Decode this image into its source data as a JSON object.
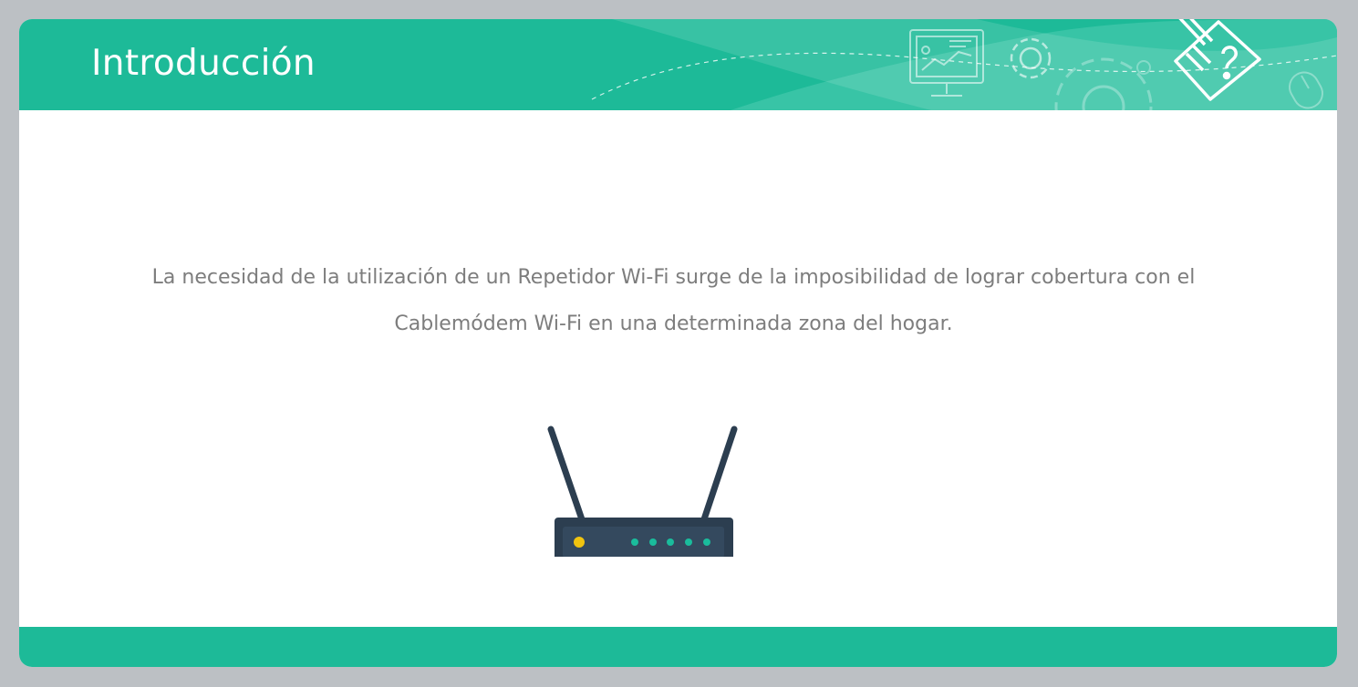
{
  "slide": {
    "title": "Introducción",
    "body_text": "La necesidad de la utilización de un Repetidor Wi-Fi surge de la imposibilidad de lograr cobertura con el Cablemódem Wi-Fi en una determinada zona del hogar."
  },
  "icons": {
    "header_decoration": [
      "presentation-monitor-icon",
      "gear-icon",
      "large-gear-icon",
      "mouse-icon",
      "help-document-icon"
    ],
    "illustration": "wifi-router-icon"
  },
  "colors": {
    "accent": "#1dba98",
    "accent_light": "#4ccdb1",
    "background": "#bcc0c4",
    "body_text": "#7d7d7d",
    "router_body": "#2c3e50",
    "router_panel": "#34495e",
    "router_power_led": "#f1c40f",
    "router_status_led": "#1abc9c"
  }
}
